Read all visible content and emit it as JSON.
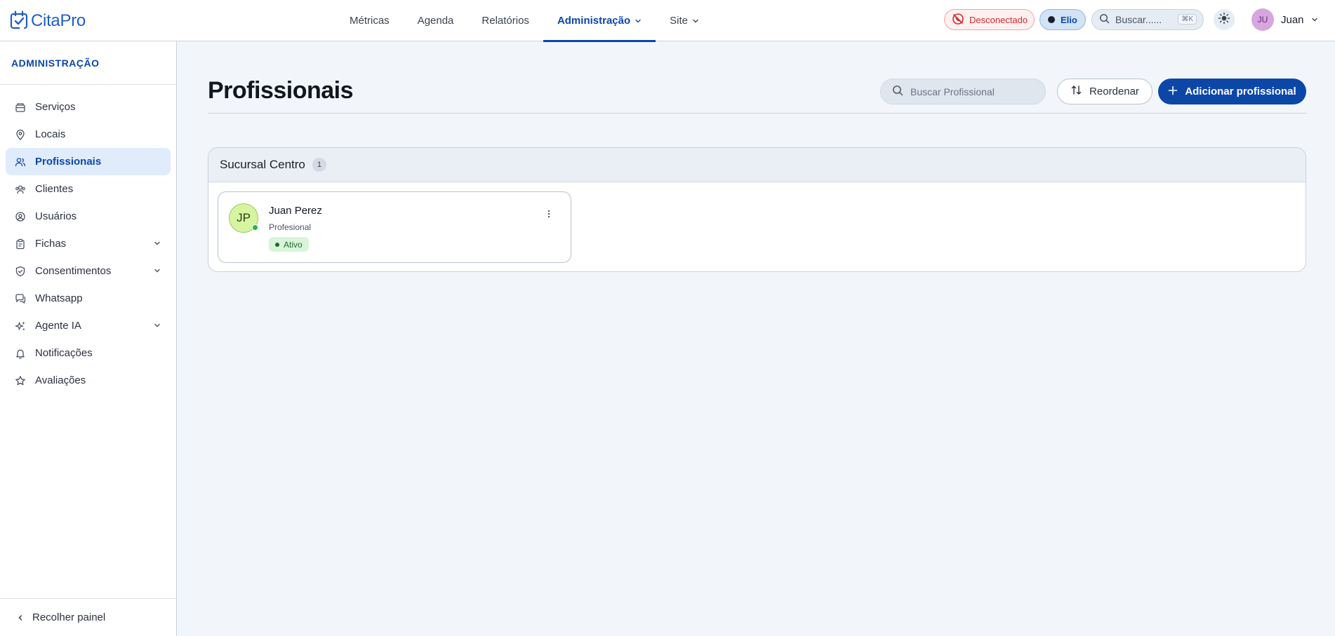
{
  "app": {
    "name": "CitaPro",
    "brand_color": "#1f5ec9",
    "accent_color": "#0c47a8"
  },
  "topnav": {
    "items": [
      {
        "label": "Métricas"
      },
      {
        "label": "Agenda"
      },
      {
        "label": "Relatórios"
      },
      {
        "label": "Administração",
        "active": true,
        "dropdown": true
      },
      {
        "label": "Site",
        "dropdown": true
      }
    ]
  },
  "toolbar": {
    "whatsapp_status": "Desconectado",
    "assistant": "Elio",
    "search_placeholder": "Buscar......",
    "search_shortcut": "⌘K",
    "theme_icon": "sun-icon",
    "user_initials": "JU",
    "user_name": "Juan"
  },
  "sidebar": {
    "title": "ADMINISTRAÇÃO",
    "items": [
      {
        "label": "Serviços",
        "icon": "box-icon"
      },
      {
        "label": "Locais",
        "icon": "map-pin-icon"
      },
      {
        "label": "Profissionais",
        "icon": "users-icon",
        "active": true
      },
      {
        "label": "Clientes",
        "icon": "contacts-icon"
      },
      {
        "label": "Usuários",
        "icon": "user-circle-icon"
      },
      {
        "label": "Fichas",
        "icon": "clipboard-icon",
        "expandable": true
      },
      {
        "label": "Consentimentos",
        "icon": "shield-icon",
        "expandable": true
      },
      {
        "label": "Whatsapp",
        "icon": "chat-icon"
      },
      {
        "label": "Agente IA",
        "icon": "sparkles-icon",
        "expandable": true
      },
      {
        "label": "Notificações",
        "icon": "bell-icon"
      },
      {
        "label": "Avaliações",
        "icon": "star-icon"
      }
    ],
    "collapse_label": "Recolher painel"
  },
  "main": {
    "title": "Profissionais",
    "search_placeholder": "Buscar Profissional",
    "reorder_label": "Reordenar",
    "add_label": "Adicionar profissional",
    "groups": [
      {
        "name": "Sucursal Centro",
        "count": "1",
        "professionals": [
          {
            "initials": "JP",
            "name": "Juan Perez",
            "role": "Profesional",
            "status": "Ativo"
          }
        ]
      }
    ]
  }
}
